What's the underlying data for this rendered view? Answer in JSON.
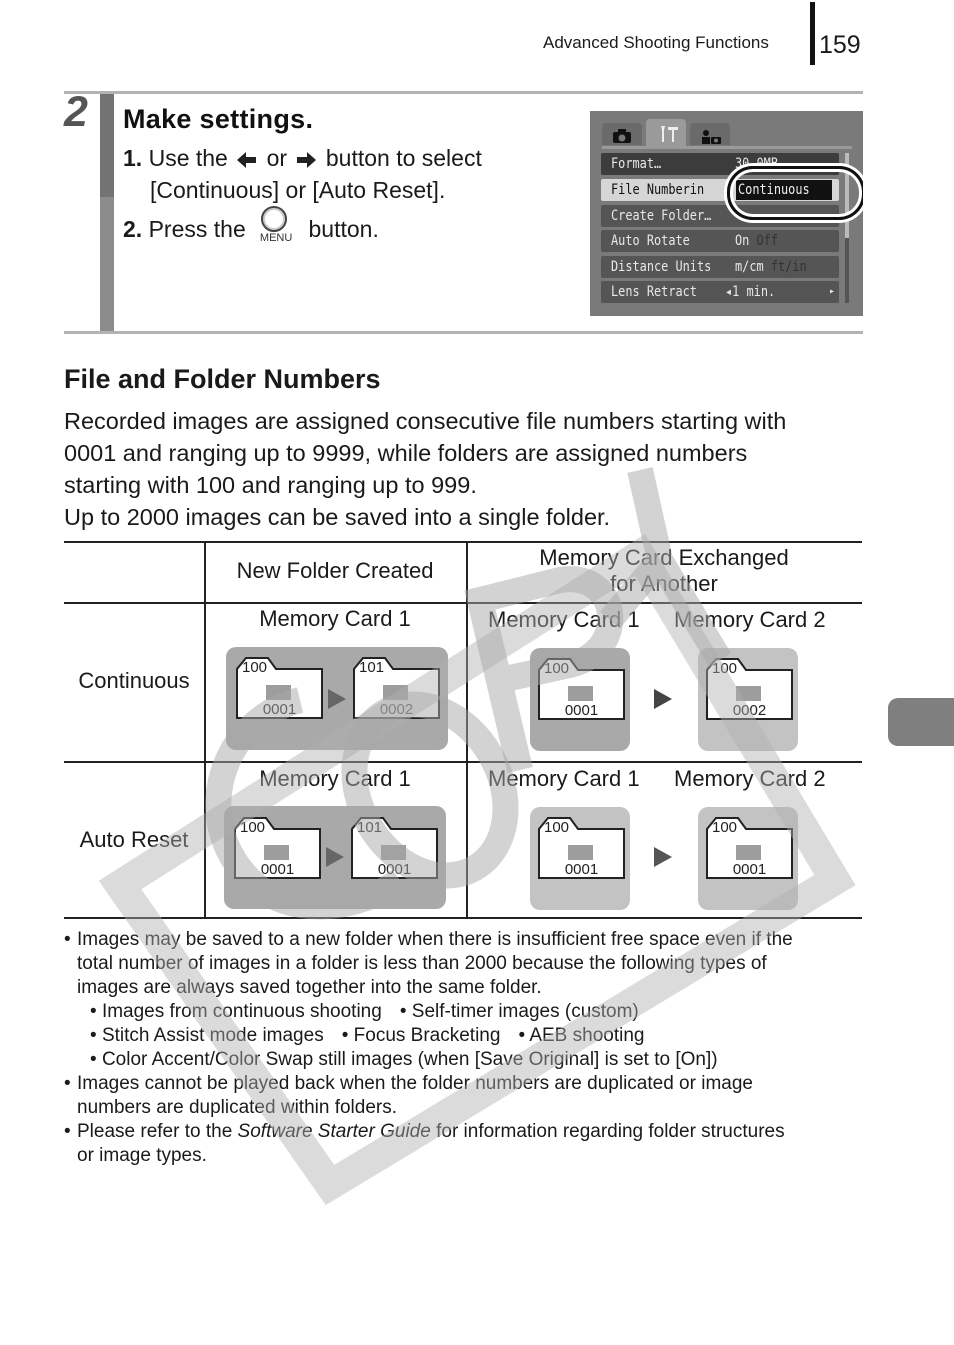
{
  "header": {
    "section_title": "Advanced Shooting Functions",
    "page_number": "159"
  },
  "step": {
    "number": "2",
    "heading": "Make settings.",
    "line1_num": "1.",
    "line1_a": "Use the",
    "line1_or": "or",
    "line1_b": "button to select",
    "line2": "[Continuous] or [Auto Reset].",
    "line3_num": "2.",
    "line3_a": "Press the",
    "line3_b": "button.",
    "menu_button_label": "MENU",
    "left_arrow_icon": "left-arrow-icon",
    "right_arrow_icon": "right-arrow-icon"
  },
  "camera_screen": {
    "tabs": [
      {
        "icon": "camera-icon",
        "active": false
      },
      {
        "icon": "tools-icon",
        "active": true
      },
      {
        "icon": "my-settings-icon",
        "active": false
      }
    ],
    "rows": [
      {
        "label": "Format…",
        "value": "30.0MB",
        "value_off": ""
      },
      {
        "label": "File Numberin",
        "value": "Continuous",
        "value_off": ""
      },
      {
        "label": "Create Folder…",
        "value": "",
        "value_off": ""
      },
      {
        "label": "Auto Rotate",
        "value": "On",
        "value_off": "Off"
      },
      {
        "label": "Distance Units",
        "value": "m/cm",
        "value_off": "ft/in"
      },
      {
        "label": "Lens Retract",
        "value": "1 min.",
        "value_off": ""
      }
    ],
    "selected_index": 1
  },
  "section": {
    "title": "File and Folder Numbers",
    "paragraph_lines": [
      "Recorded images are assigned consecutive file numbers starting with",
      "0001 and ranging up to 9999, while folders are assigned numbers",
      "starting with 100 and ranging up to 999.",
      "Up to 2000 images can be saved into a single folder."
    ]
  },
  "table": {
    "headers": [
      "",
      "New Folder Created",
      "Memory Card Exchanged",
      "for Another"
    ],
    "rows": [
      {
        "label": "Continuous",
        "new_folder": {
          "card": "Memory Card 1",
          "from": {
            "folder": "100",
            "file": "0001"
          },
          "to": {
            "folder": "101",
            "file": "0002"
          }
        },
        "exchanged": {
          "card1": "Memory Card 1",
          "card2": "Memory Card 2",
          "from": {
            "folder": "100",
            "file": "0001"
          },
          "to": {
            "folder": "100",
            "file": "0002"
          }
        }
      },
      {
        "label": "Auto Reset",
        "new_folder": {
          "card": "Memory Card 1",
          "from": {
            "folder": "100",
            "file": "0001"
          },
          "to": {
            "folder": "101",
            "file": "0001"
          }
        },
        "exchanged": {
          "card1": "Memory Card 1",
          "card2": "Memory Card 2",
          "from": {
            "folder": "100",
            "file": "0001"
          },
          "to": {
            "folder": "100",
            "file": "0001"
          }
        }
      }
    ]
  },
  "notes": {
    "n1_lines": [
      "Images may be saved to a new folder when there is insufficient free space even if the",
      "total number of images in a folder is less than 2000 because the following types of",
      "images are always saved together into the same folder."
    ],
    "n1_sub_row1": [
      "Images from continuous shooting",
      "Self-timer images (custom)"
    ],
    "n1_sub_row2": [
      "Stitch Assist mode images",
      "Focus Bracketing",
      "AEB shooting"
    ],
    "n1_sub_row3": [
      "Color Accent/Color Swap still images (when [Save Original] is set to [On])"
    ],
    "n2_lines": [
      "Images cannot be played back when the folder numbers are duplicated or image",
      "numbers are duplicated within folders."
    ],
    "n3_a": "Please refer to the",
    "n3_italic": "Software Starter Guide",
    "n3_b": "for information regarding folder structures",
    "n3_line2": "or image types."
  },
  "watermark": {
    "text": "COPY"
  }
}
